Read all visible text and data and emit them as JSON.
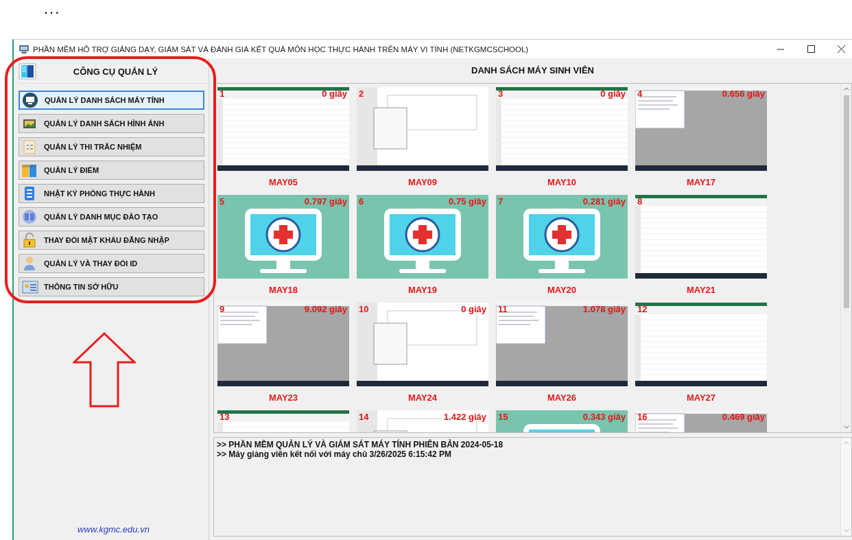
{
  "page_menu": "...",
  "window": {
    "title": "PHẦN MỀM HỖ TRỢ GIẢNG DẠY, GIÁM SÁT VÀ ĐÁNH GIÁ KẾT QUẢ MÔN HỌC THỰC HÀNH TRÊN MÁY VI TÍNH (NETKGMCSCHOOL)"
  },
  "sidebar": {
    "title": "CÔNG CỤ QUẢN LÝ",
    "items": [
      {
        "label": "QUẢN LÝ DANH SÁCH MÁY TÍNH",
        "selected": true
      },
      {
        "label": "QUẢN LÝ DANH SÁCH HÌNH ẢNH",
        "selected": false
      },
      {
        "label": "QUẢN LÝ THI TRẮC NHIỆM",
        "selected": false
      },
      {
        "label": "QUẢN LÝ ĐIỂM",
        "selected": false
      },
      {
        "label": "NHẬT KÝ PHÒNG THỰC HÀNH",
        "selected": false
      },
      {
        "label": "QUẢN LÝ DANH MỤC ĐÀO TẠO",
        "selected": false
      },
      {
        "label": "THAY ĐỔI MẬT KHẨU ĐĂNG NHẬP",
        "selected": false
      },
      {
        "label": "QUẢN LÝ VÀ THAY ĐỔI ID",
        "selected": false
      },
      {
        "label": "THÔNG TIN SỞ HỮU",
        "selected": false
      }
    ],
    "link": "www.kgmc.edu.vn"
  },
  "main": {
    "title": "DANH SÁCH MÁY SINH VIÊN",
    "machines": [
      {
        "number": "1",
        "time": "0 giây",
        "name": "MAY05"
      },
      {
        "number": "2",
        "name": "MAY09"
      },
      {
        "number": "3",
        "time": "0 giây",
        "name": "MAY10"
      },
      {
        "number": "4",
        "time": "0.656 giây",
        "name": "MAY17"
      },
      {
        "number": "5",
        "time": "0.797 giây",
        "name": "MAY18"
      },
      {
        "number": "6",
        "time": "0.75 giây",
        "name": "MAY19"
      },
      {
        "number": "7",
        "time": "0.281 giây",
        "name": "MAY20"
      },
      {
        "number": "8",
        "name": "MAY21"
      },
      {
        "number": "9",
        "time": "9.092 giây",
        "name": "MAY23"
      },
      {
        "number": "10",
        "time": "0 giây",
        "name": "MAY24"
      },
      {
        "number": "11",
        "time": "1.078 giây",
        "name": "MAY26"
      },
      {
        "number": "12",
        "name": "MAY27"
      },
      {
        "number": "13"
      },
      {
        "number": "14",
        "time": "1.422 giây"
      },
      {
        "number": "15",
        "time": "0.343 giây"
      },
      {
        "number": "16",
        "time": "0.469 giây"
      }
    ],
    "log": [
      ">> PHẦN MỀM QUẢN LÝ VÀ GIÁM SÁT MÁY TÍNH PHIÊN BẢN 2024-05-18",
      ">> Máy giảng viên kết nối với máy chủ 3/26/2025 6:15:42 PM"
    ]
  }
}
